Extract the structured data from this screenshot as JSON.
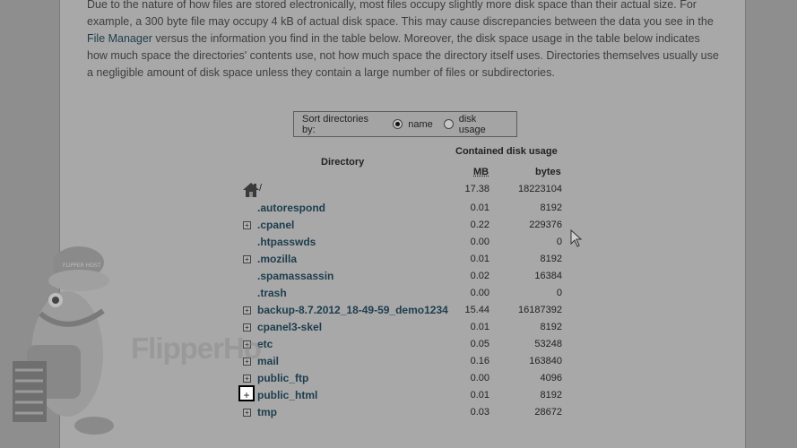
{
  "intro": {
    "line1": "Due to the nature of how files are stored electronically, most files occupy slightly more disk space than their actual size. For",
    "line2a": "example, a 300 byte file may occupy 4 kB of actual disk space. This may cause discrepancies between the data you see in the ",
    "link": "File Manager",
    "line3": " versus the information you find in the table below. Moreover, the disk space usage in the table below indicates how much space the directories' contents use, not how much space the directory itself uses. Directories themselves usually use a negligible amount of disk space unless they contain a large number of files or subdirectories."
  },
  "sort": {
    "label": "Sort directories by:",
    "options": [
      {
        "label": "name",
        "selected": true
      },
      {
        "label": "disk usage",
        "selected": false
      }
    ]
  },
  "table": {
    "dir_header": "Directory",
    "contained_header": "Contained disk usage",
    "mb_header": "MB",
    "bytes_header": "bytes",
    "root": {
      "name": "/",
      "mb": "17.38",
      "bytes": "18223104"
    },
    "rows": [
      {
        "name": ".autorespond",
        "mb": "0.01",
        "bytes": "8192",
        "expandable": false
      },
      {
        "name": ".cpanel",
        "mb": "0.22",
        "bytes": "229376",
        "expandable": true
      },
      {
        "name": ".htpasswds",
        "mb": "0.00",
        "bytes": "0",
        "expandable": false
      },
      {
        "name": ".mozilla",
        "mb": "0.01",
        "bytes": "8192",
        "expandable": true
      },
      {
        "name": ".spamassassin",
        "mb": "0.02",
        "bytes": "16384",
        "expandable": false
      },
      {
        "name": ".trash",
        "mb": "0.00",
        "bytes": "0",
        "expandable": false
      },
      {
        "name": "backup-8.7.2012_18-49-59_demo1234",
        "mb": "15.44",
        "bytes": "16187392",
        "expandable": true
      },
      {
        "name": "cpanel3-skel",
        "mb": "0.01",
        "bytes": "8192",
        "expandable": true
      },
      {
        "name": "etc",
        "mb": "0.05",
        "bytes": "53248",
        "expandable": true
      },
      {
        "name": "mail",
        "mb": "0.16",
        "bytes": "163840",
        "expandable": true
      },
      {
        "name": "public_ftp",
        "mb": "0.00",
        "bytes": "4096",
        "expandable": true
      },
      {
        "name": "public_html",
        "mb": "0.01",
        "bytes": "8192",
        "expandable": true,
        "highlighted": true
      },
      {
        "name": "tmp",
        "mb": "0.03",
        "bytes": "28672",
        "expandable": true
      }
    ]
  },
  "expand_glyph": "+",
  "watermark": {
    "cap": "FLIPPER HOST",
    "text": "FlipperHo"
  },
  "colors": {
    "link": "#1d3d4d",
    "background": "#a8a8a8"
  }
}
